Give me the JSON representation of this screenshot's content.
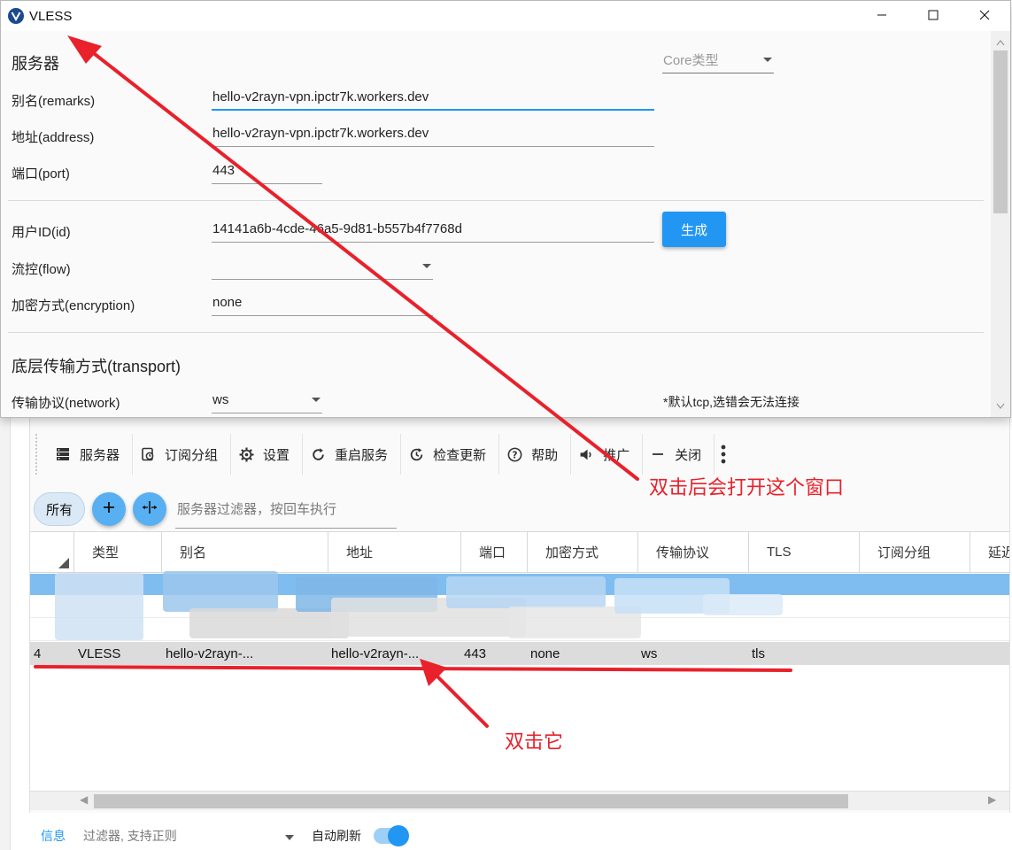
{
  "dialog": {
    "title": "VLESS",
    "section_server": "服务器",
    "core_type_placeholder": "Core类型",
    "fields": {
      "remarks_label": "别名(remarks)",
      "remarks_value": "hello-v2rayn-vpn.ipctr7k.workers.dev",
      "address_label": "地址(address)",
      "address_value": "hello-v2rayn-vpn.ipctr7k.workers.dev",
      "port_label": "端口(port)",
      "port_value": "443",
      "id_label": "用户ID(id)",
      "id_value": "14141a6b-4cde-46a5-9d81-b557b4f7768d",
      "generate_button": "生成",
      "flow_label": "流控(flow)",
      "flow_value": "",
      "encryption_label": "加密方式(encryption)",
      "encryption_value": "none"
    },
    "section_transport": "底层传输方式(transport)",
    "network_label": "传输协议(network)",
    "network_value": "ws",
    "network_hint": "*默认tcp,选错会无法连接"
  },
  "toolbar": {
    "servers": "服务器",
    "subscription": "订阅分组",
    "settings": "设置",
    "restart": "重启服务",
    "check_update": "检查更新",
    "help": "帮助",
    "promote": "推广",
    "close": "关闭"
  },
  "filter": {
    "chip_all": "所有",
    "placeholder": "服务器过滤器，按回车执行"
  },
  "grid": {
    "columns": [
      "类型",
      "别名",
      "地址",
      "端口",
      "加密方式",
      "传输协议",
      "TLS",
      "订阅分组",
      "延迟"
    ],
    "row4": {
      "index": "4",
      "type": "VLESS",
      "remarks": "hello-v2rayn-...",
      "address": "hello-v2rayn-...",
      "port": "443",
      "encryption": "none",
      "network": "ws",
      "tls": "tls"
    }
  },
  "statusbar": {
    "info_tab": "信息",
    "filter_placeholder": "过滤器, 支持正则",
    "auto_refresh": "自动刷新",
    "auto_refresh_on": true
  },
  "annotations": {
    "open_window_note": "双击后会打开这个窗口",
    "double_click_note": "双击它",
    "color": "#e8212b"
  }
}
